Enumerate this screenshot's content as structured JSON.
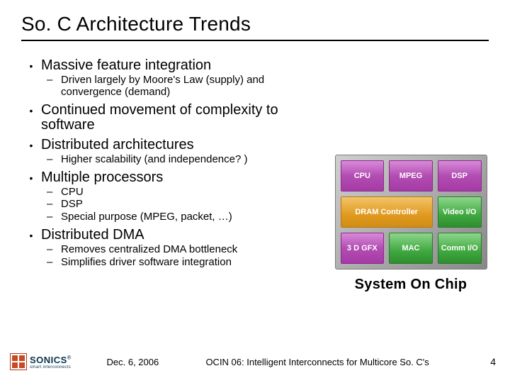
{
  "title": "So. C Architecture Trends",
  "bullets": {
    "b1": "Massive feature integration",
    "b1a": "Driven largely by Moore's Law (supply) and convergence (demand)",
    "b2": "Continued movement of complexity to software",
    "b3": "Distributed architectures",
    "b3a": "Higher scalability (and independence? )",
    "b4": "Multiple processors",
    "b4a": "CPU",
    "b4b": "DSP",
    "b4c": "Special purpose (MPEG, packet, …)",
    "b5": "Distributed DMA",
    "b5a": "Removes centralized DMA bottleneck",
    "b5b": "Simplifies driver software integration"
  },
  "diagram": {
    "blocks": {
      "cpu": "CPU",
      "mpeg": "MPEG",
      "dsp": "DSP",
      "dram": "DRAM Controller",
      "video": "Video I/O",
      "gfx": "3 D GFX",
      "mac": "MAC",
      "comm": "Comm I/O"
    },
    "caption": "System On Chip"
  },
  "footer": {
    "logo_name": "SONICS",
    "logo_reg": "®",
    "logo_tag": "smart interconnects",
    "date": "Dec. 6, 2006",
    "center": "OCIN 06: Intelligent Interconnects for Multicore So. C's",
    "page": "4"
  }
}
